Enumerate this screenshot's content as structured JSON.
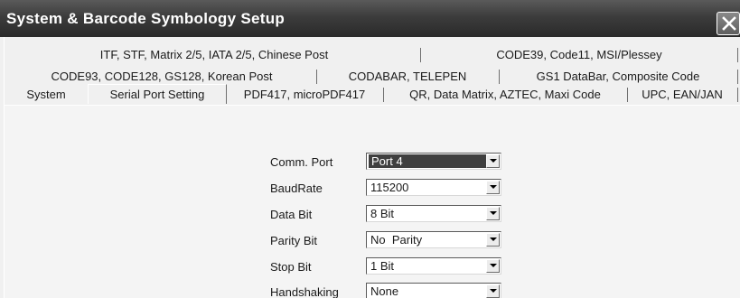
{
  "window": {
    "title": "System & Barcode Symbology Setup",
    "close_icon": "close-icon"
  },
  "tabs": {
    "row1": [
      "ITF, STF, Matrix 2/5, IATA 2/5, Chinese Post",
      "CODE39, Code11, MSI/Plessey"
    ],
    "row2": [
      "CODE93, CODE128, GS128, Korean Post",
      "CODABAR, TELEPEN",
      "GS1 DataBar, Composite Code"
    ],
    "row3": [
      "System",
      "Serial Port Setting",
      "PDF417, microPDF417",
      "QR, Data Matrix, AZTEC, Maxi Code",
      "UPC, EAN/JAN"
    ],
    "active": "Serial Port Setting"
  },
  "serial": {
    "fields": [
      {
        "label": "Comm. Port",
        "value": "Port 4"
      },
      {
        "label": "BaudRate",
        "value": "115200"
      },
      {
        "label": "Data Bit",
        "value": "8 Bit"
      },
      {
        "label": "Parity Bit",
        "value": "No  Parity"
      },
      {
        "label": "Stop Bit",
        "value": "1 Bit"
      },
      {
        "label": "Handshaking",
        "value": "None"
      }
    ],
    "dropdown_icon": "chevron-down-icon"
  }
}
